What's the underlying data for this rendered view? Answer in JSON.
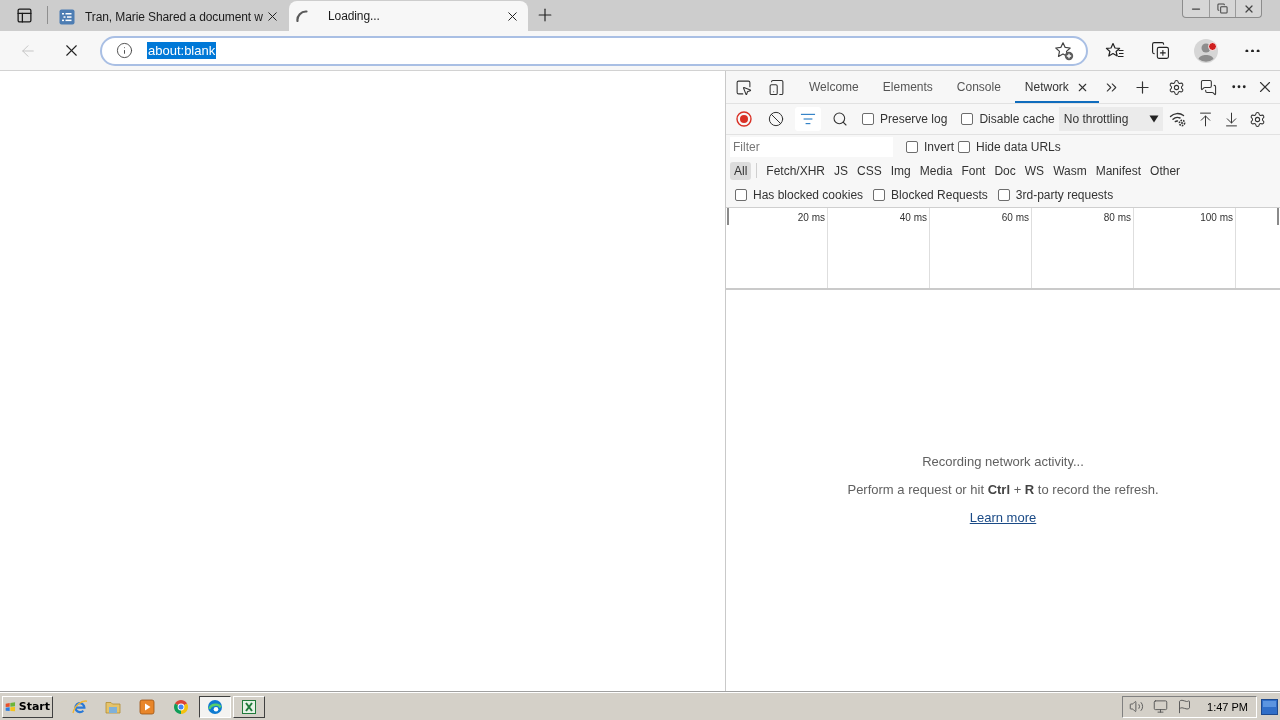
{
  "browser": {
    "tabs": [
      {
        "kind": "document",
        "title": "Tran, Marie Shared a document w",
        "selected": false
      },
      {
        "kind": "loading",
        "title": "Loading...",
        "selected": true
      }
    ],
    "navigation": {
      "back_disabled": true,
      "loading": true
    },
    "address_bar": {
      "value": "about:blank",
      "highlighted": true
    },
    "profile": {
      "notification": true
    }
  },
  "devtools": {
    "tabs": [
      {
        "label": "Welcome",
        "selected": false,
        "closable": false
      },
      {
        "label": "Elements",
        "selected": false,
        "closable": false
      },
      {
        "label": "Console",
        "selected": false,
        "closable": false
      },
      {
        "label": "Network",
        "selected": true,
        "closable": true
      }
    ],
    "toolbar": {
      "recording": true,
      "filter_open": true,
      "options": [
        {
          "label": "Preserve log",
          "checked": false
        },
        {
          "label": "Disable cache",
          "checked": false
        }
      ],
      "throttling": "No throttling"
    },
    "filter": {
      "placeholder": "Filter",
      "options": [
        {
          "label": "Invert",
          "checked": false
        },
        {
          "label": "Hide data URLs",
          "checked": false
        }
      ]
    },
    "resource_types": [
      {
        "label": "All",
        "selected": true
      },
      {
        "label": "Fetch/XHR",
        "selected": false
      },
      {
        "label": "JS",
        "selected": false
      },
      {
        "label": "CSS",
        "selected": false
      },
      {
        "label": "Img",
        "selected": false
      },
      {
        "label": "Media",
        "selected": false
      },
      {
        "label": "Font",
        "selected": false
      },
      {
        "label": "Doc",
        "selected": false
      },
      {
        "label": "WS",
        "selected": false
      },
      {
        "label": "Wasm",
        "selected": false
      },
      {
        "label": "Manifest",
        "selected": false
      },
      {
        "label": "Other",
        "selected": false
      }
    ],
    "request_filters": [
      {
        "label": "Has blocked cookies",
        "checked": false
      },
      {
        "label": "Blocked Requests",
        "checked": false
      },
      {
        "label": "3rd-party requests",
        "checked": false
      }
    ],
    "overview": {
      "ticks": [
        "20 ms",
        "40 ms",
        "60 ms",
        "80 ms",
        "100 ms"
      ]
    },
    "empty_state": {
      "title": "Recording network activity...",
      "hint": "Perform a request or hit **Ctrl** + **R** to record the refresh.",
      "link": "Learn more"
    }
  },
  "taskbar": {
    "start": "Start",
    "apps": [
      {
        "kind": "ie",
        "open": false,
        "active": false
      },
      {
        "kind": "folder",
        "open": false,
        "active": false
      },
      {
        "kind": "media",
        "open": false,
        "active": false
      },
      {
        "kind": "chrome",
        "open": false,
        "active": false
      },
      {
        "kind": "edge",
        "open": true,
        "active": true
      },
      {
        "kind": "excel",
        "open": true,
        "active": false
      }
    ],
    "clock": "1:47 PM"
  }
}
